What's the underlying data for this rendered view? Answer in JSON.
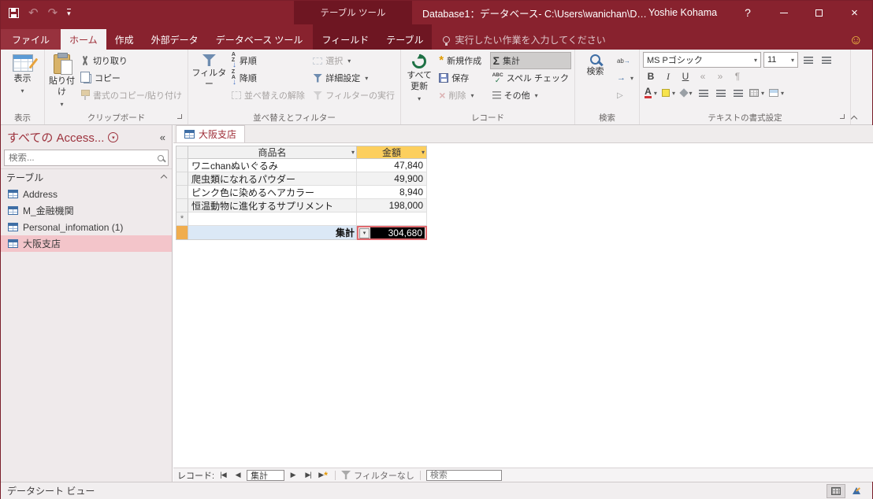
{
  "titlebar": {
    "tool_label": "テーブル ツール",
    "title": "Database1：データベース- C:\\Users\\wanichan\\D…",
    "user": "Yoshie Kohama",
    "help": "?"
  },
  "tabs": {
    "file": "ファイル",
    "home": "ホーム",
    "create": "作成",
    "external": "外部データ",
    "dbtools": "データベース ツール",
    "fields": "フィールド",
    "table": "テーブル",
    "tellme": "実行したい作業を入力してください"
  },
  "ribbon": {
    "view": {
      "label": "表示",
      "group": "表示"
    },
    "clipboard": {
      "paste": "貼り付け",
      "cut": "切り取り",
      "copy": "コピー",
      "painter": "書式のコピー/貼り付け",
      "group": "クリップボード"
    },
    "sort": {
      "filter": "フィルター",
      "asc": "昇順",
      "desc": "降順",
      "clear": "並べ替えの解除",
      "selection": "選択",
      "advanced": "詳細設定",
      "toggle": "フィルターの実行",
      "group": "並べ替えとフィルター"
    },
    "records": {
      "refresh_1": "すべて",
      "refresh_2": "更新",
      "new": "新規作成",
      "save": "保存",
      "delete": "削除",
      "totals": "集計",
      "spell": "スペル チェック",
      "more": "その他",
      "group": "レコード"
    },
    "find": {
      "find": "検索",
      "group": "検索"
    },
    "text": {
      "font": "MS Pゴシック",
      "size": "11",
      "group": "テキストの書式設定"
    }
  },
  "nav": {
    "header": "すべての Access...",
    "search_placeholder": "検索...",
    "group": "テーブル",
    "items": [
      {
        "label": "Address"
      },
      {
        "label": "M_金融機関"
      },
      {
        "label": "Personal_infomation (1)"
      },
      {
        "label": "大阪支店"
      }
    ]
  },
  "sheet": {
    "doc_tab": "大阪支店",
    "col_name": "商品名",
    "col_amount": "金額",
    "rows": [
      {
        "name": "ワニchanぬいぐるみ",
        "amount": "47,840"
      },
      {
        "name": "爬虫類になれるパウダー",
        "amount": "49,900"
      },
      {
        "name": "ピンク色に染めるヘアカラー",
        "amount": "8,940"
      },
      {
        "name": "恒温動物に進化するサプリメント",
        "amount": "198,000"
      }
    ],
    "new_row_marker": "*",
    "total_label": "集計",
    "total_value": "304,680"
  },
  "recnav": {
    "label": "レコード:",
    "current": "集計",
    "filter": "フィルターなし",
    "search_placeholder": "検索"
  },
  "statusbar": {
    "view": "データシート ビュー"
  },
  "icons": {
    "undo": "↶",
    "redo": "↷",
    "close": "×",
    "smiley": "☺",
    "collapse_pane": "«",
    "letter_a": "A",
    "letter_z": "Z",
    "spell_abc": "ABC",
    "asterisk": "*",
    "bold": "B",
    "italic": "I",
    "underline": "U",
    "font_color_a": "A",
    "replace_ab": "ab"
  },
  "colors": {
    "accent_red": "#88222e",
    "accent_red_dark": "#6e1622",
    "amount_header_bg": "#fccf5e",
    "selection_pink": "#f3c5ca",
    "total_row_blue": "#dbe8f6",
    "selector_orange": "#f0ad4e",
    "total_border_red": "#e0696f"
  }
}
